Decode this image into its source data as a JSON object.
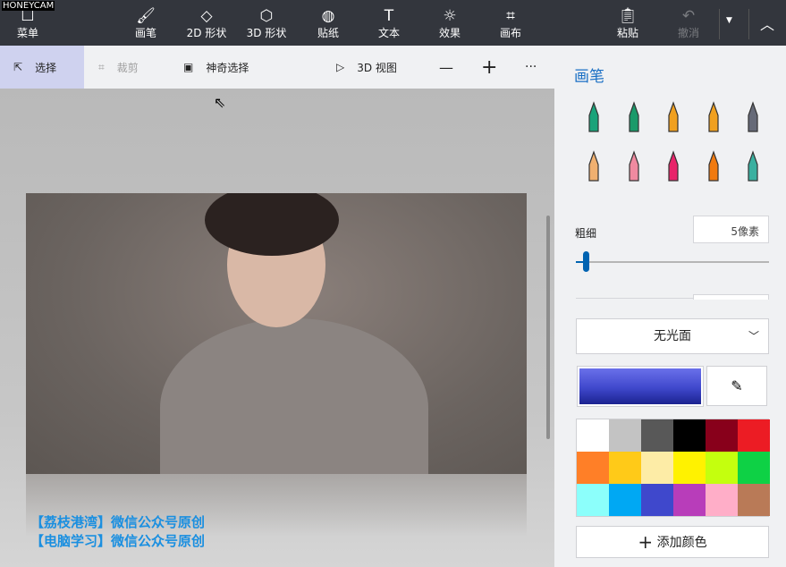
{
  "watermark": "HONEYCAM",
  "topbar": {
    "menu": "菜单",
    "tools": [
      "画笔",
      "2D 形状",
      "3D 形状",
      "贴纸",
      "文本",
      "效果",
      "画布"
    ],
    "paste": "粘贴",
    "undo": "撤消"
  },
  "toolbar": {
    "select": "选择",
    "crop": "裁剪",
    "magic_select": "神奇选择",
    "view3d": "3D 视图",
    "zoom_out": "—",
    "zoom_in": "+",
    "more": "···"
  },
  "canvas": {
    "watermark_lines": [
      "【荔枝港湾】微信公众号原创",
      "【电脑学习】微信公众号原创"
    ]
  },
  "panel": {
    "title": "画笔",
    "size_label": "粗细",
    "size_value": "5像素",
    "size_fraction": 0.05,
    "finish": "无光面",
    "add_color": "添加颜色",
    "brushes": [
      {
        "name": "marker",
        "color": "#1aa37a"
      },
      {
        "name": "calligraphy-pen",
        "color": "#1a9a6a"
      },
      {
        "name": "oil-brush",
        "color": "#f0a020"
      },
      {
        "name": "watercolor",
        "color": "#f0a020"
      },
      {
        "name": "pixel-pen",
        "color": "#666a78"
      },
      {
        "name": "pencil",
        "color": "#f0b070"
      },
      {
        "name": "eraser",
        "color": "#f08aa0"
      },
      {
        "name": "crayon",
        "color": "#e8246a"
      },
      {
        "name": "spray-can",
        "color": "#f07a10"
      },
      {
        "name": "fill",
        "color": "#3ab0a0"
      }
    ],
    "current_color": "#3f48cc",
    "palette": [
      "#ffffff",
      "#c3c3c3",
      "#585858",
      "#000000",
      "#88001b",
      "#ec1c24",
      "#ff7f27",
      "#ffca18",
      "#fdeca6",
      "#fff200",
      "#c4ff0e",
      "#0ed145",
      "#8cfffb",
      "#00a8f3",
      "#3f48cc",
      "#b83dba",
      "#ffaec8",
      "#b97a57"
    ]
  }
}
